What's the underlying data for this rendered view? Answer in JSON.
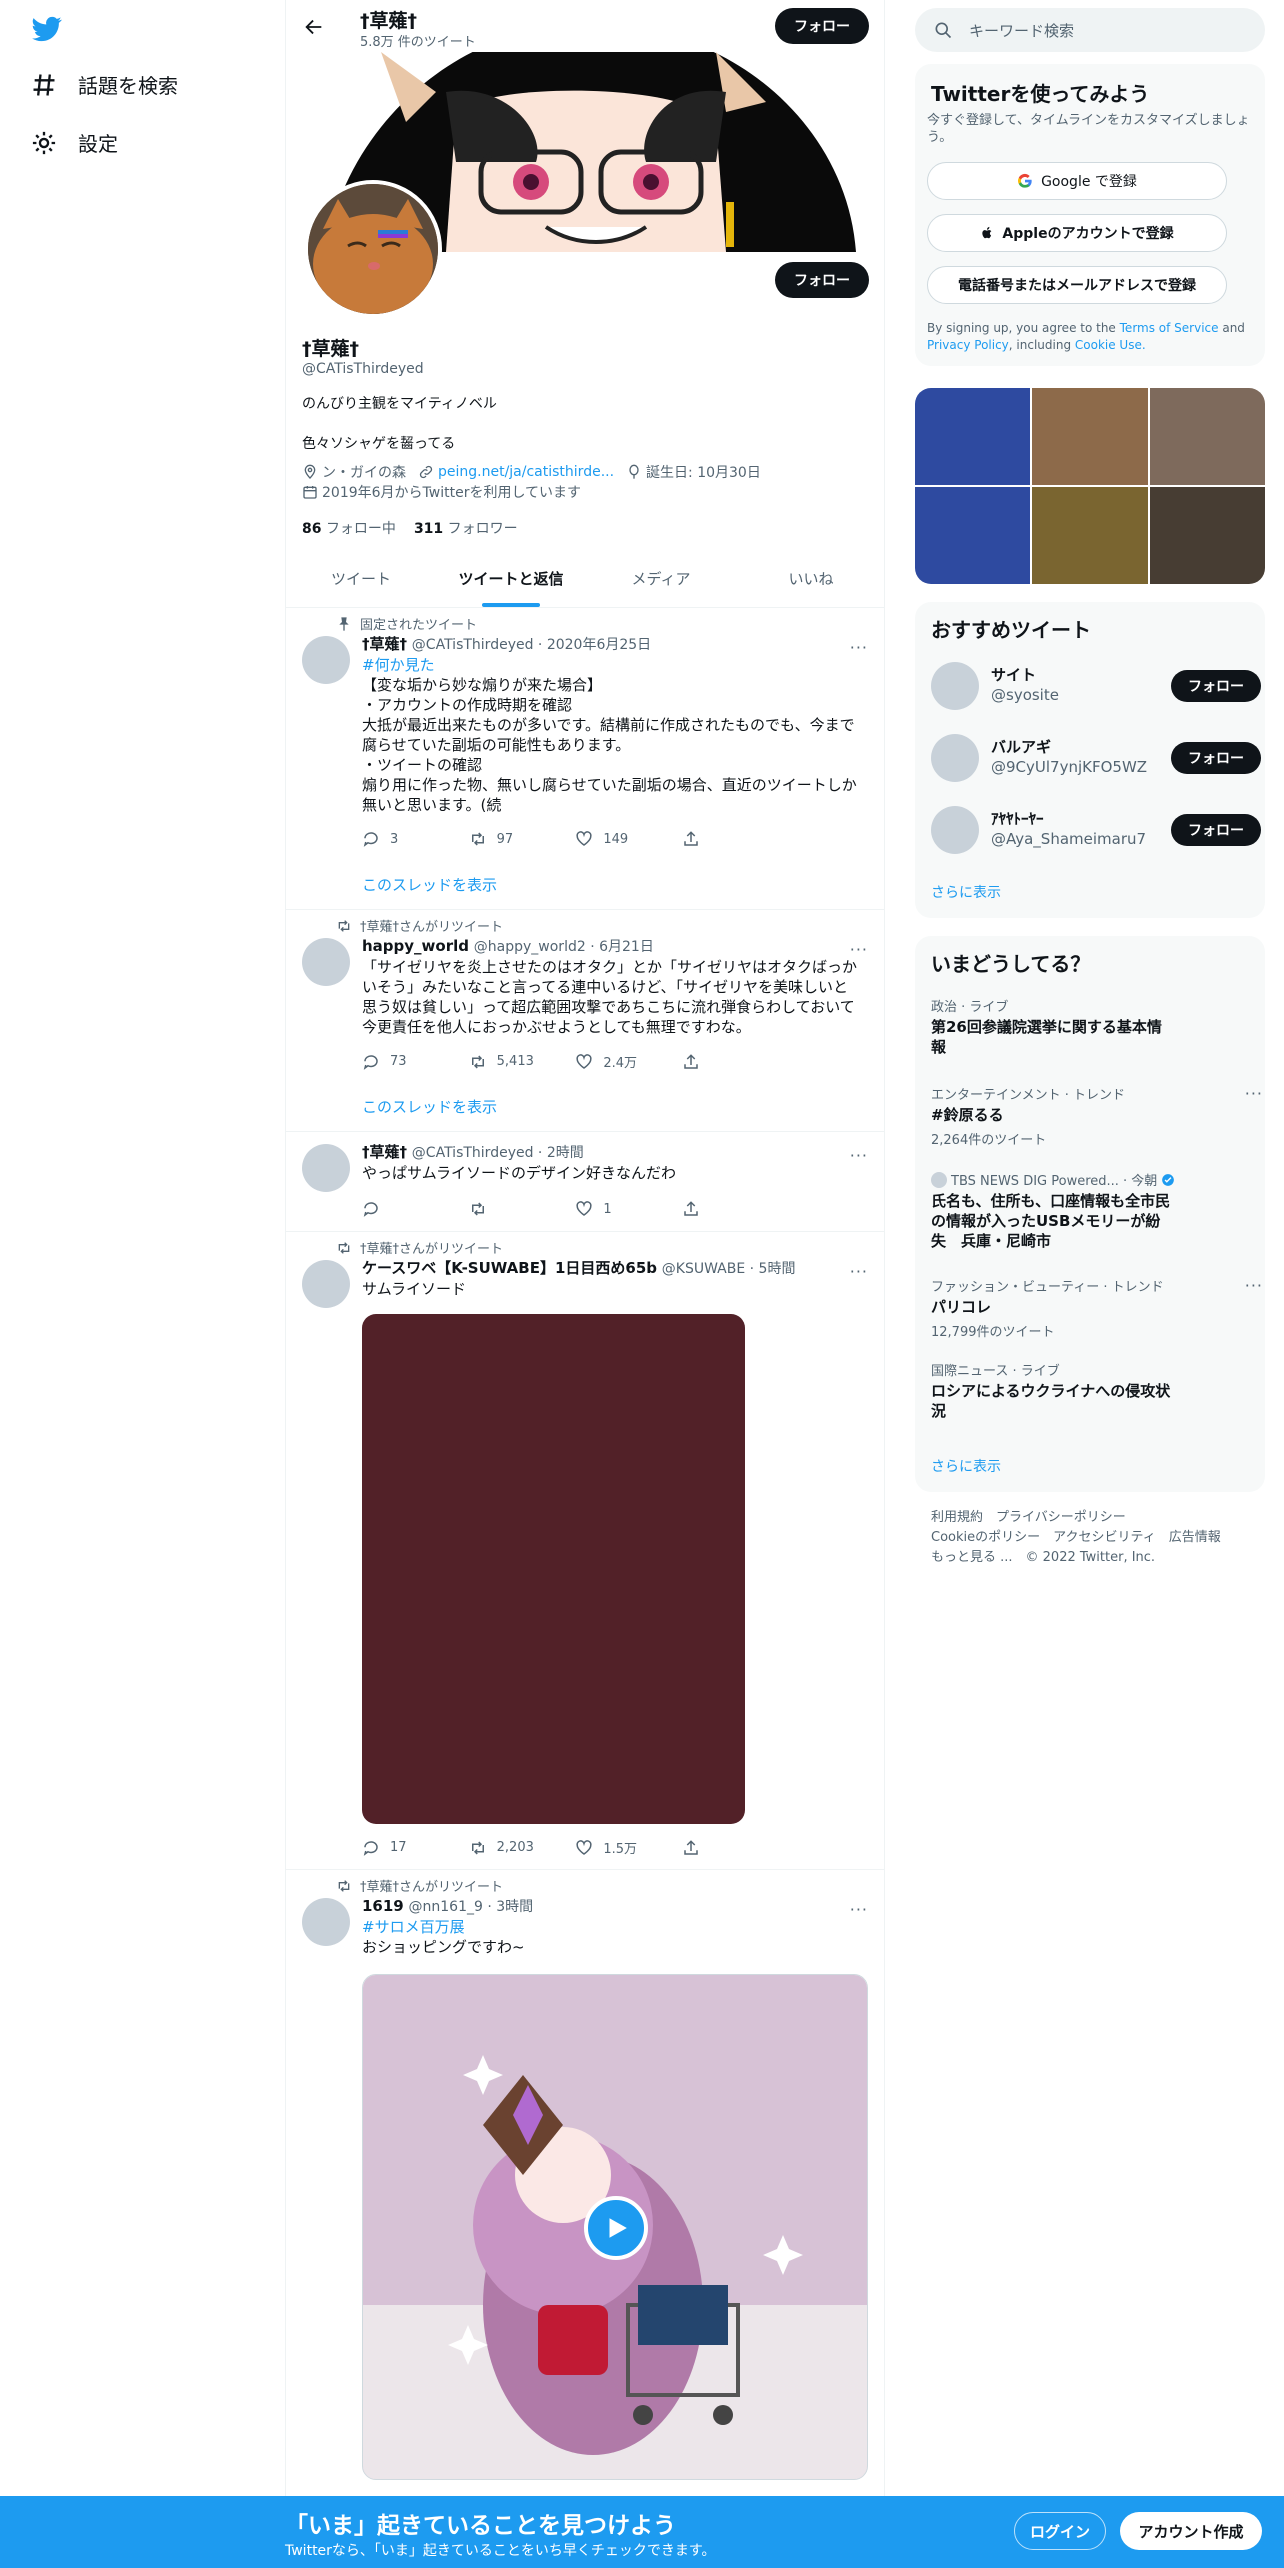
{
  "nav": {
    "explore_label": "話題を検索",
    "settings_label": "設定"
  },
  "header": {
    "name": "†草薙†",
    "tweet_count": "5.8万 件のツイート",
    "follow_label": "フォロー"
  },
  "profile": {
    "name": "†草薙†",
    "handle": "@CATisThirdeyed",
    "bio_line1": "のんびり主観をマイティノベル",
    "bio_line2": "色々ソシャゲを齧ってる",
    "location": "ン・ガイの森",
    "website": "peing.net/ja/catisthirde...",
    "birthday": "誕生日: 10月30日",
    "joined": "2019年6月からTwitterを利用しています",
    "following_count": "86",
    "following_label": "フォロー中",
    "followers_count": "311",
    "followers_label": "フォロワー",
    "follow_label": "フォロー"
  },
  "tabs": [
    {
      "label": "ツイート"
    },
    {
      "label": "ツイートと返信"
    },
    {
      "label": "メディア"
    },
    {
      "label": "いいね"
    }
  ],
  "tweets": [
    {
      "context": "固定されたツイート",
      "name": "†草薙†",
      "handle_time": "@CATisThirdeyed · 2020年6月25日",
      "hashtag": "#何か見た",
      "lines": [
        "【変な垢から妙な煽りが来た場合】",
        "・アカウントの作成時期を確認",
        "大抵が最近出来たものが多いです。結構前に作成されたものでも、今まで",
        "腐らせていた副垢の可能性もあります。",
        "・ツイートの確認",
        "煽り用に作った物、無いし腐らせていた副垢の場合、直近のツイートしか",
        "無いと思います。(続"
      ],
      "replies": "3",
      "retweets": "97",
      "likes": "149",
      "thread_link": "このスレッドを表示"
    },
    {
      "context": "†草薙†さんがリツイート",
      "name": "happy_world",
      "handle_time": "@happy_world2 · 6月21日",
      "lines": [
        "「サイゼリヤを炎上させたのはオタク」とか「サイゼリヤはオタクばっか",
        "いそう」みたいなこと言ってる連中いるけど、「サイゼリヤを美味しいと",
        "思う奴は貧しい」って超広範囲攻撃であちこちに流れ弾食らわしておいて",
        "今更責任を他人におっかぶせようとしても無理ですわな。"
      ],
      "replies": "73",
      "retweets": "5,413",
      "likes": "2.4万",
      "thread_link": "このスレッドを表示"
    },
    {
      "name": "†草薙†",
      "handle_time": "@CATisThirdeyed · 2時間",
      "lines": [
        "やっぱサムライソードのデザイン好きなんだわ"
      ],
      "replies": "",
      "retweets": "",
      "likes": "1"
    },
    {
      "context": "†草薙†さんがリツイート",
      "name": "ケースワベ【K-SUWABE】1日目西め65b",
      "handle_time": "@KSUWABE · 5時間",
      "lines": [
        "サムライソード"
      ],
      "media_color": "#522128",
      "replies": "17",
      "retweets": "2,203",
      "likes": "1.5万"
    },
    {
      "context": "†草薙†さんがリツイート",
      "name": "1619",
      "handle_time": "@nn161_9 · 3時間",
      "hashtag": "#サロメ百万展",
      "lines": [
        "おショッピングですわ~"
      ]
    }
  ],
  "right": {
    "search_placeholder": "キーワード検索",
    "signup": {
      "title": "Twitterを使ってみよう",
      "subtitle": "今すぐ登録して、タイムラインをカスタマイズしましょう。",
      "google": "Google で登録",
      "apple": "Appleのアカウントで登録",
      "phone": "電話番号またはメールアドレスで登録",
      "terms_pre": "By signing up, you agree to the ",
      "terms_link": "Terms of Service",
      "terms_and": " and",
      "privacy_link": "Privacy Policy",
      "including": ", including ",
      "cookie_link": "Cookie Use."
    },
    "media_grid_colors": [
      "#2e4aa0",
      "#8d6a4a",
      "#7e6a5c",
      "#2e4aa0",
      "#7a6530",
      "#473d33"
    ],
    "recommended": {
      "title": "おすすめツイート",
      "users": [
        {
          "name": "サイト",
          "handle": "@syosite"
        },
        {
          "name": "バルアギ",
          "handle": "@9CyUl7ynjKFO5WZ"
        },
        {
          "name": "ｱﾔﾔﾄｰﾔｰ",
          "handle": "@Aya_Shameimaru7"
        }
      ],
      "follow_label": "フォロー",
      "show_more": "さらに表示"
    },
    "trends": {
      "title": "いまどうしてる？",
      "items": [
        {
          "category": "政治 · ライブ",
          "title": "第26回参議院選挙に関する基本情報",
          "count": ""
        },
        {
          "category": "エンターテインメント · トレンド",
          "title": "#鈴原るる",
          "count": "2,264件のツイート"
        },
        {
          "category": "TBS NEWS DIG Powered... · 今朝",
          "title": "氏名も、住所も、口座情報も全市民の情報が入ったUSBメモリーが紛失　兵庫・尼崎市",
          "count": ""
        },
        {
          "category": "ファッション・ビューティー · トレンド",
          "title": "パリコレ",
          "count": "12,799件のツイート"
        },
        {
          "category": "国際ニュース · ライブ",
          "title": "ロシアによるウクライナへの侵攻状況",
          "count": ""
        }
      ],
      "show_more": "さらに表示"
    },
    "footer": {
      "line1": "利用規約　プライバシーポリシー",
      "line2": "Cookieのポリシー　アクセシビリティ　広告情報",
      "line3": "もっと見る ...　© 2022 Twitter, Inc."
    }
  },
  "bottombar": {
    "headline": "「いま」起きていることを見つけよう",
    "subline": "Twitterなら、「いま」起きていることをいち早くチェックできます。",
    "login": "ログイン",
    "signup": "アカウント作成"
  }
}
